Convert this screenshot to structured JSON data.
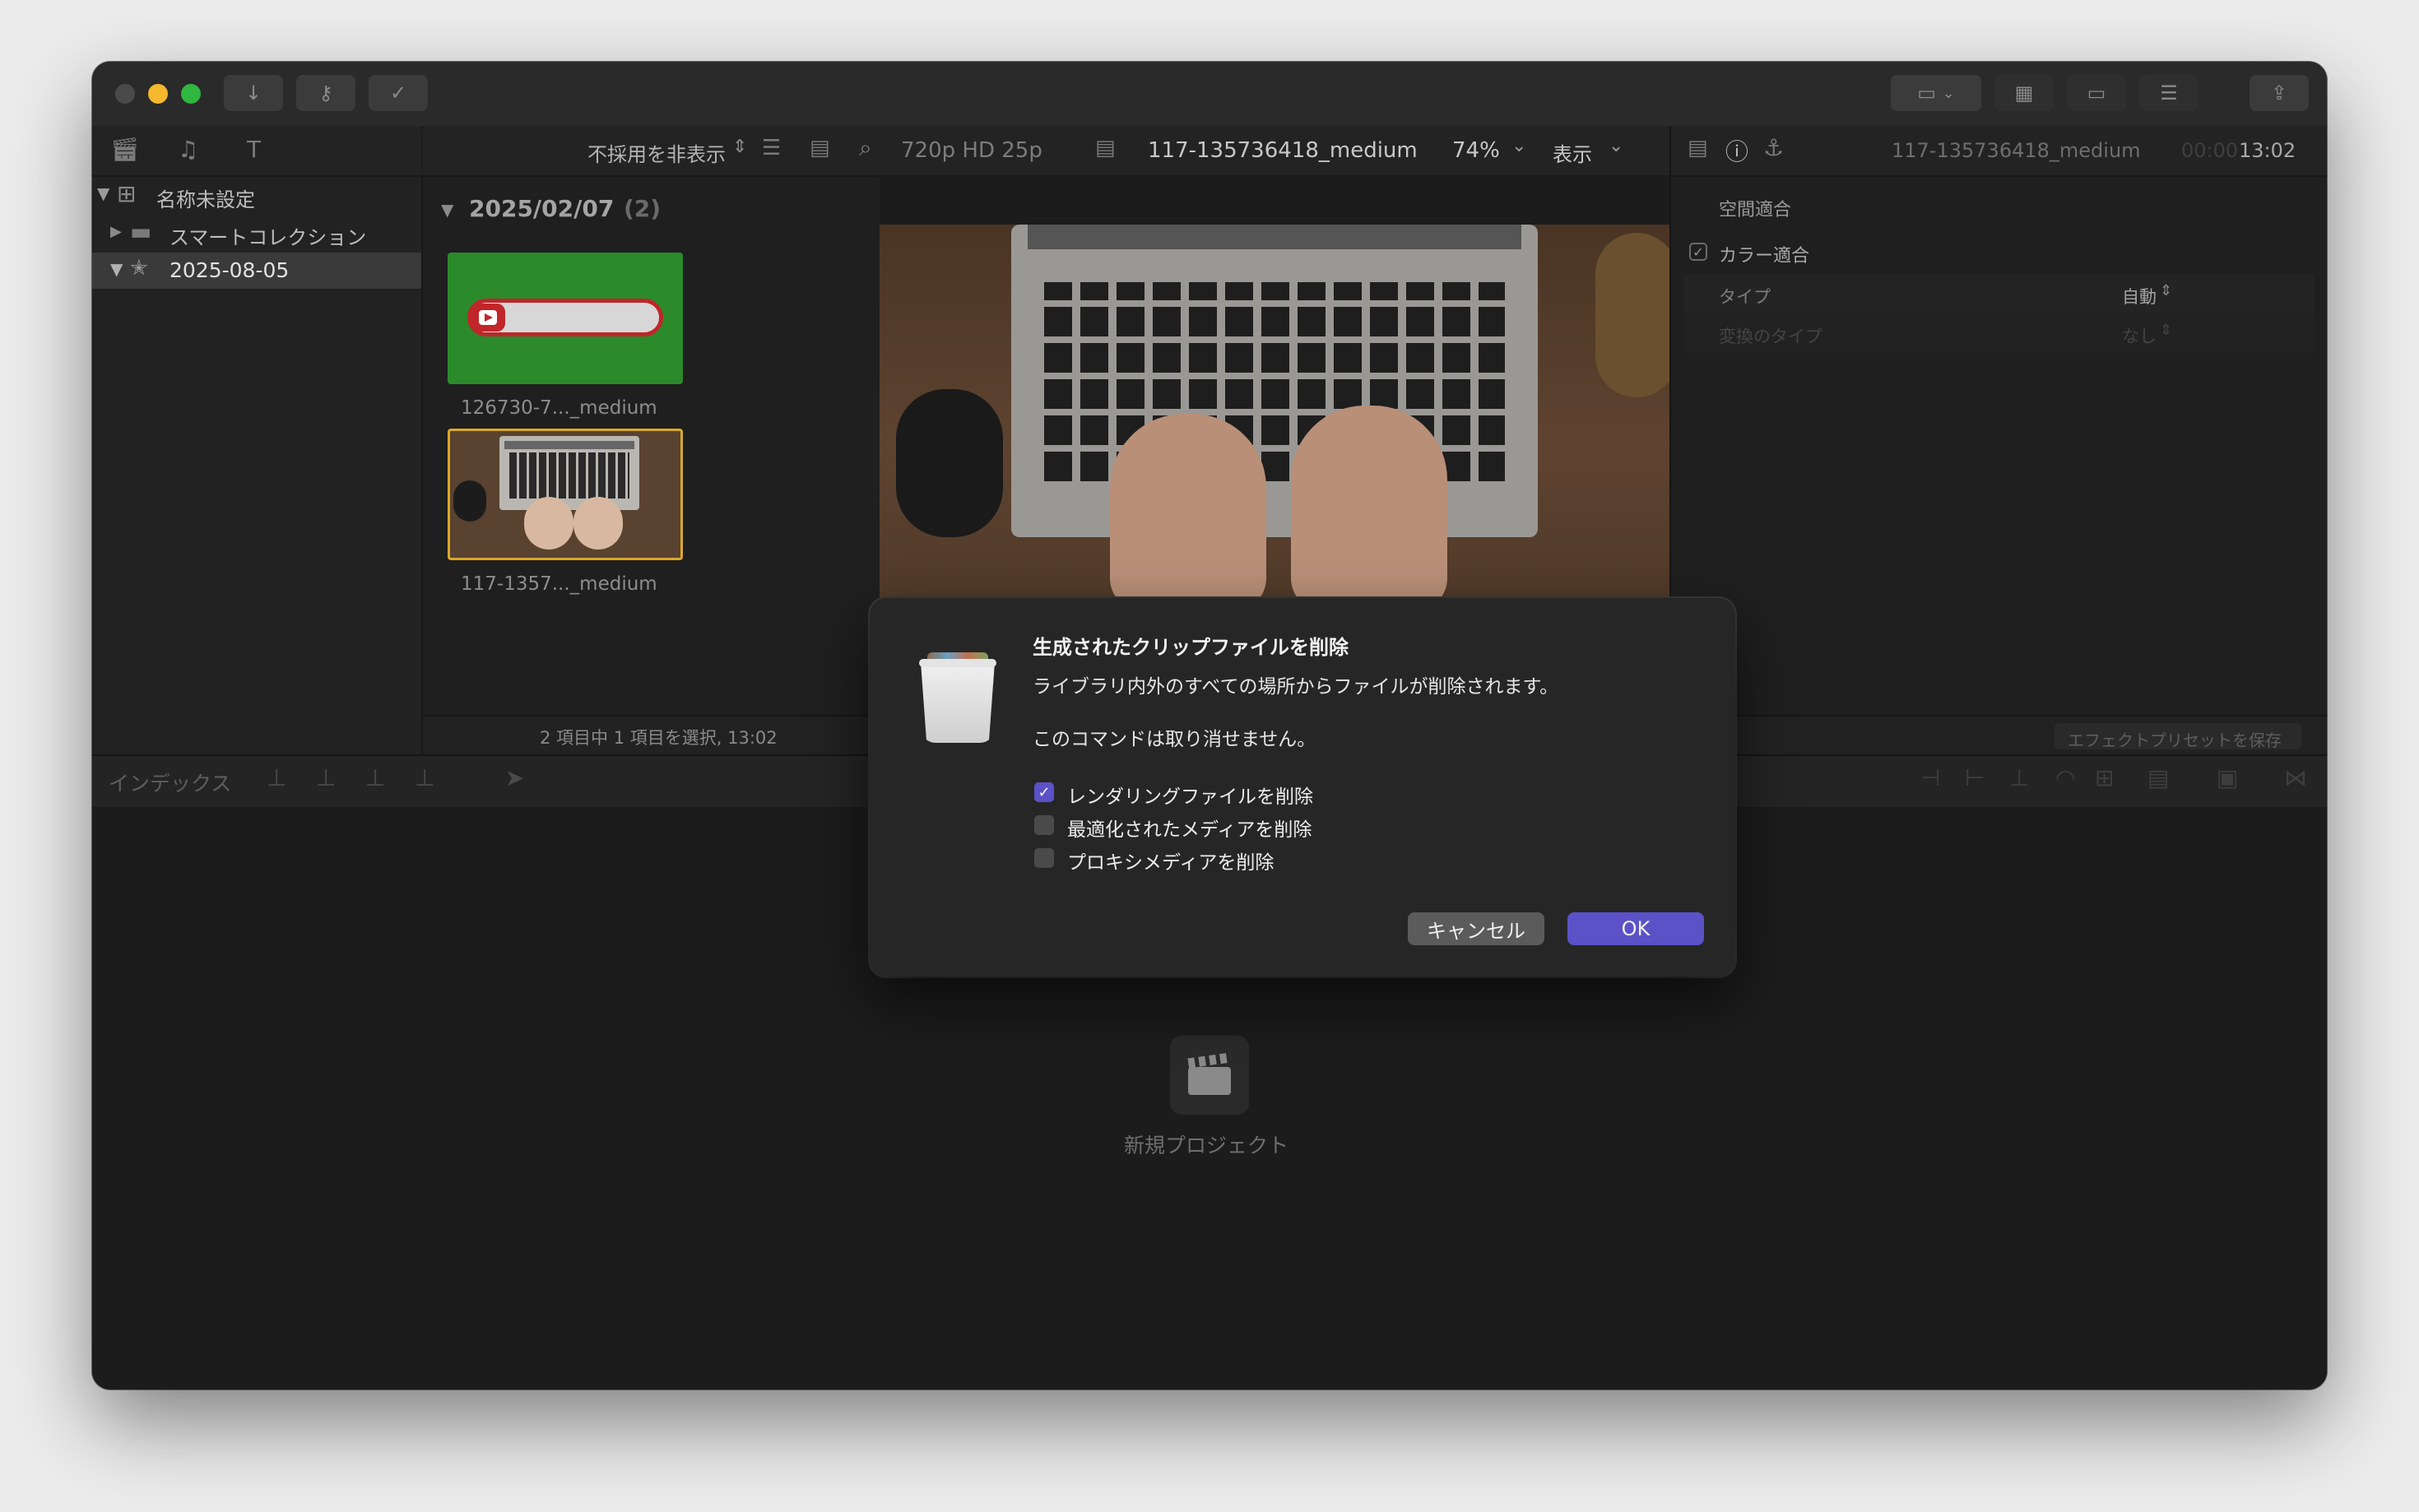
{
  "toolbar": {
    "import_icon": "download-arrow-icon",
    "keywords_icon": "key-icon",
    "background_tasks_icon": "checkmark-circle-icon"
  },
  "browser_header": {
    "filter_label": "不採用を非表示",
    "filter_chevron": "⌃⌄"
  },
  "viewer_header": {
    "format": "720p HD 25p",
    "clip_name": "117-135736418_medium",
    "zoom": "74%",
    "view_label": "表示"
  },
  "inspector_header": {
    "clip_name": "117-135736418_medium",
    "timecode_dim": "00:00",
    "timecode": "13:02"
  },
  "sidebar": {
    "items": [
      {
        "label": "名称未設定"
      },
      {
        "label": "スマートコレクション"
      },
      {
        "label": "2025-08-05"
      }
    ]
  },
  "browser": {
    "group_date": "2025/02/07",
    "group_count": "(2)",
    "clips": [
      {
        "name": "126730-7..._medium"
      },
      {
        "name": "117-1357..._medium"
      }
    ],
    "status": "2 項目中 1 項目を選択, 13:02"
  },
  "inspector": {
    "spatial_conform": "空間適合",
    "color_conform": "カラー適合",
    "type_label": "タイプ",
    "type_value": "自動",
    "conversion_label": "変換のタイプ",
    "conversion_value": "なし",
    "save_preset": "エフェクトプリセットを保存"
  },
  "timeline": {
    "index_label": "インデックス",
    "new_project": "新規プロジェクト"
  },
  "dialog": {
    "title": "生成されたクリップファイルを削除",
    "message": "ライブラリ内外のすべての場所からファイルが削除されます。",
    "warning": "このコマンドは取り消せません。",
    "options": [
      {
        "label": "レンダリングファイルを削除",
        "checked": true
      },
      {
        "label": "最適化されたメディアを削除",
        "checked": false
      },
      {
        "label": "プロキシメディアを削除",
        "checked": false
      }
    ],
    "cancel_label": "キャンセル",
    "ok_label": "OK"
  },
  "colors": {
    "accent": "#5a52c6",
    "close": "#4a4a4a",
    "minimize": "#f3b82d",
    "zoom": "#2fb740",
    "selection": "#3a3a3a"
  }
}
